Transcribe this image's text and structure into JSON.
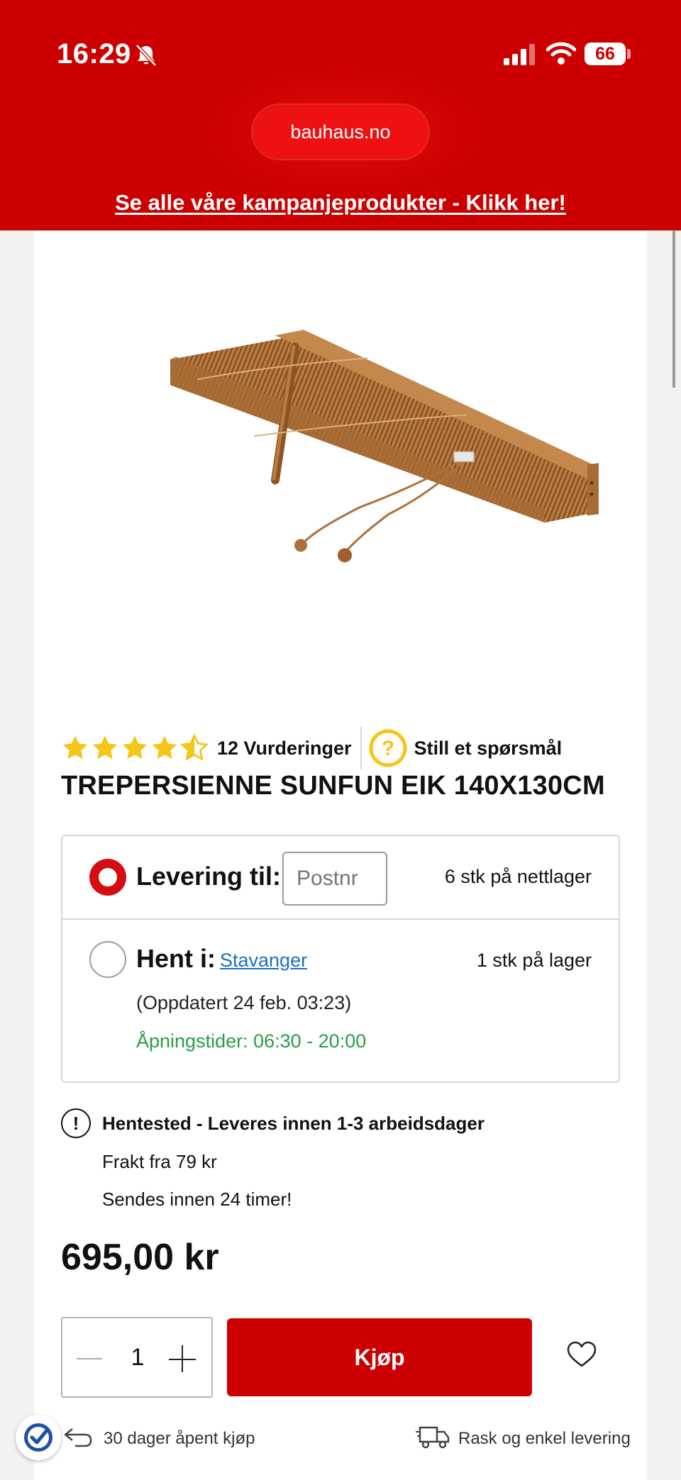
{
  "status_bar": {
    "time": "16:29",
    "battery": "66"
  },
  "browser": {
    "url": "bauhaus.no"
  },
  "campaign_banner": {
    "text": "Se alle våre kampanjeprodukter - Klikk her!"
  },
  "product": {
    "rating_value": 4.5,
    "rating_max": 5,
    "reviews_label": "12 Vurderinger",
    "ask_label": "Still et spørsmål",
    "title": "TREPERSIENNE SUNFUN EIK 140X130CM",
    "price": "695,00 kr"
  },
  "delivery": {
    "option_delivery": {
      "label": "Levering til:",
      "postnr_placeholder": "Postnr",
      "stock": "6 stk på nettlager",
      "selected": true
    },
    "option_pickup": {
      "label": "Hent i:",
      "store": "Stavanger",
      "stock": "1 stk på lager",
      "updated": "(Oppdatert 24 feb. 03:23)",
      "opening_hours": "Åpningstider: 06:30 - 20:00",
      "selected": false
    }
  },
  "shipping": {
    "title": "Hentested - Leveres innen 1-3 arbeidsdager",
    "freight": "Frakt fra 79 kr",
    "dispatch": "Sendes innen 24 timer!"
  },
  "purchase": {
    "quantity": "1",
    "buy_label": "Kjøp"
  },
  "perks": {
    "returns": "30 dager åpent kjøp",
    "delivery": "Rask og enkel levering"
  },
  "colors": {
    "brand_red": "#cc0000",
    "link_blue": "#1a6fc2",
    "open_green": "#2a9d47",
    "star_yellow": "#f5c518"
  }
}
